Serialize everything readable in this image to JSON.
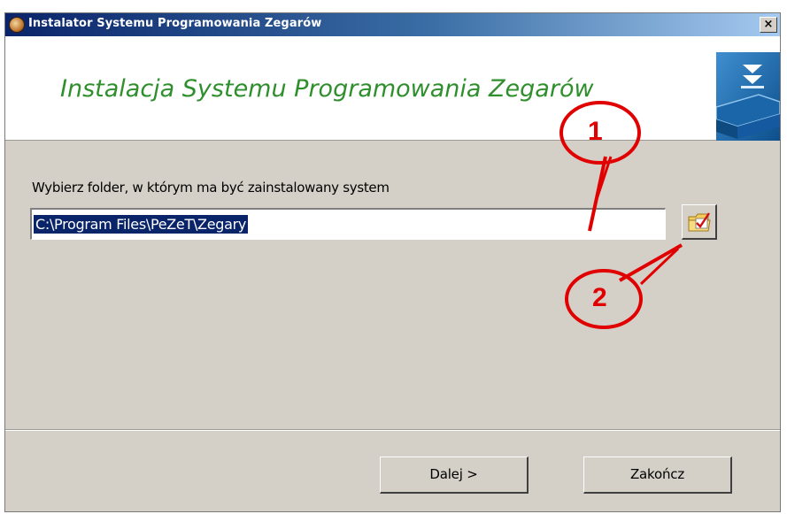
{
  "window": {
    "title": "Instalator Systemu Programowania Zegarów",
    "close_label": "×"
  },
  "header": {
    "title": "Instalacja Systemu Programowania Zegarów"
  },
  "main": {
    "prompt": "Wybierz folder, w którym ma być zainstalowany system",
    "path_value": "C:\\Program Files\\PeZeT\\Zegary"
  },
  "annotations": {
    "label_1": "1",
    "label_2": "2",
    "color": "#e00000"
  },
  "footer": {
    "next_label": "Dalej >",
    "finish_label": "Zakończ"
  },
  "colors": {
    "title_bar": "#0a246a",
    "header_title": "#2f8f2c",
    "dialog_bg": "#d4d0c8",
    "selection": "#0a246a"
  },
  "icons": {
    "title": "app-clock-icon",
    "header": "install-logo-icon",
    "browse": "folder-check-icon"
  }
}
